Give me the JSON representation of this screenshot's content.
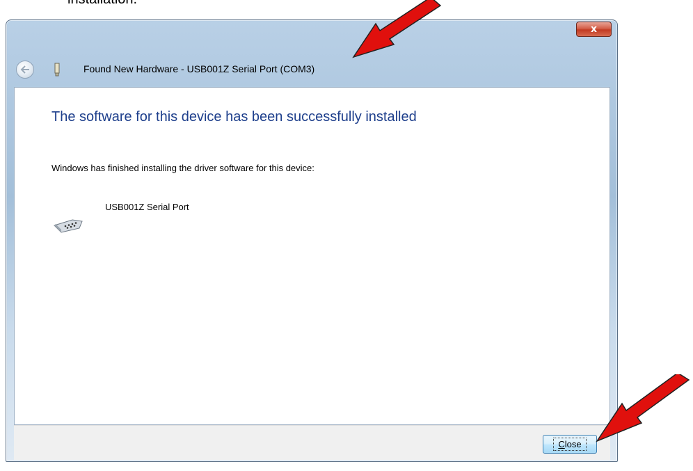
{
  "document": {
    "caption": "installation."
  },
  "window": {
    "title": "Found New Hardware - USB001Z Serial Port (COM3)",
    "close_glyph": "x",
    "icons": {
      "back": "back-arrow-icon",
      "hardware": "usb-device-icon",
      "device": "serial-port-icon"
    }
  },
  "content": {
    "heading": "The software for this device has been successfully installed",
    "message": "Windows has finished installing the driver software for this device:",
    "device_name": "USB001Z Serial Port"
  },
  "footer": {
    "close_accel": "C",
    "close_rest": "lose"
  },
  "colors": {
    "heading": "#1e3f8c",
    "arrow": "#e0100d",
    "close_chrome": "#c23a22"
  },
  "annotations": [
    "red-arrow-title",
    "red-arrow-close"
  ]
}
